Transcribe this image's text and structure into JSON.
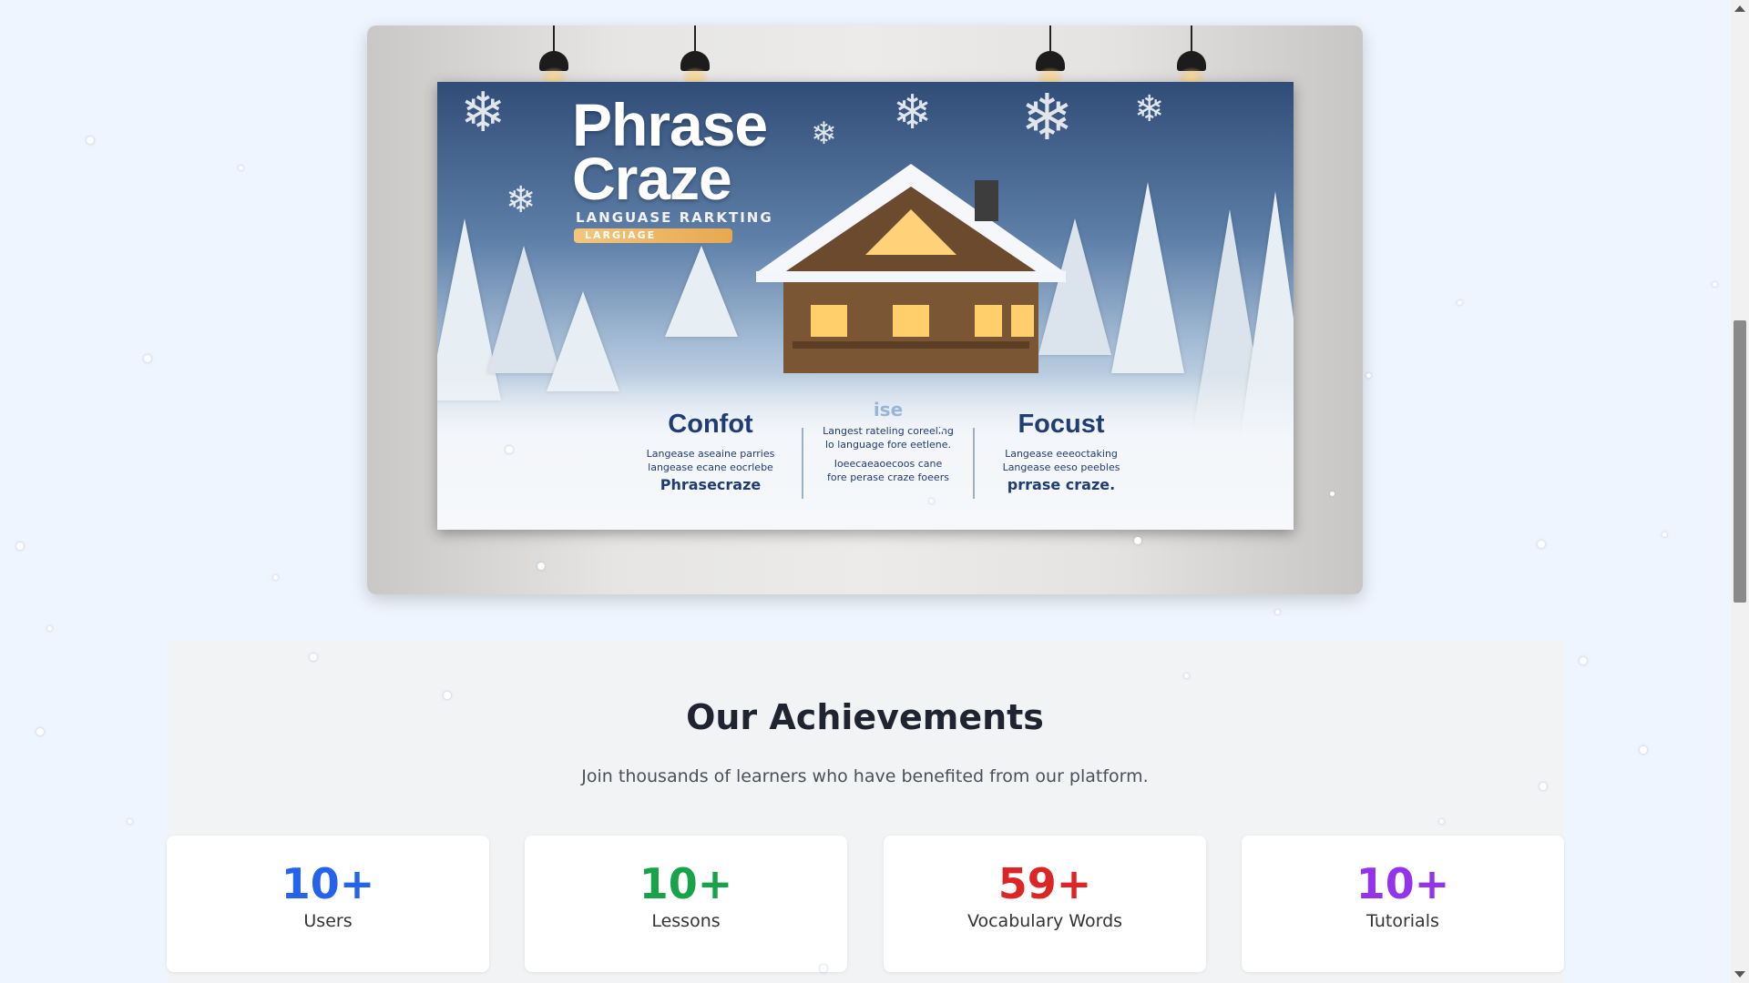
{
  "hero": {
    "poster": {
      "title_line1": "Phrase",
      "title_line2": "Craze",
      "tagline": "LANGUASE RARKTING",
      "tagline_bar": "LARGIAGE",
      "features": [
        {
          "title": "Confot",
          "text1": "Langease aseaine parries",
          "text2": "langease ecane eocrlebe",
          "sub": "Phrasecraze"
        },
        {
          "title": "ise",
          "text1": "Langest rateling coreeling",
          "text2": "lo language fore eetlene.",
          "text3": "Ioeecaeaoecoos cane",
          "text4": "fore perase craze foeers"
        },
        {
          "title": "Focust",
          "text1": "Langease eeeoctaking",
          "text2": "Langease eeso peebles",
          "sub": "prrase craze."
        }
      ]
    }
  },
  "achievements": {
    "title": "Our Achievements",
    "subtitle": "Join thousands of learners who have benefited from our platform.",
    "stats": [
      {
        "value": "10+",
        "label": "Users",
        "color": "#2563eb"
      },
      {
        "value": "10+",
        "label": "Lessons",
        "color": "#16a34a"
      },
      {
        "value": "59+",
        "label": "Vocabulary Words",
        "color": "#dc2626"
      },
      {
        "value": "10+",
        "label": "Tutorials",
        "color": "#9333ea"
      }
    ]
  },
  "icons": {
    "lamp": "pendant-lamp-icon",
    "snowflake": "snowflake-icon",
    "scroll_up": "scroll-up-arrow-icon",
    "scroll_down": "scroll-down-arrow-icon"
  }
}
